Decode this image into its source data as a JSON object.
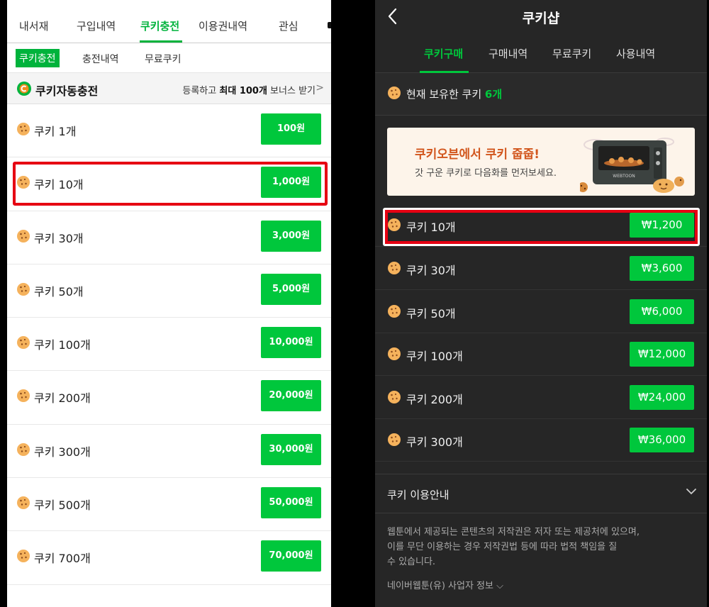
{
  "left": {
    "top_tabs": [
      "내서재",
      "구입내역",
      "쿠키충전",
      "이용권내역",
      "관심"
    ],
    "sub_tabs": [
      "쿠키충전",
      "충전내역",
      "무료쿠키"
    ],
    "auto_charge": {
      "title": "쿠키자동충전",
      "promo_prefix": "등록하고 ",
      "promo_bold": "최대 100개",
      "promo_suffix": " 보너스 받기",
      "chevron": ">"
    },
    "items": [
      {
        "label": "쿠키 1개",
        "price": "100원"
      },
      {
        "label": "쿠키 10개",
        "price": "1,000원"
      },
      {
        "label": "쿠키 30개",
        "price": "3,000원"
      },
      {
        "label": "쿠키 50개",
        "price": "5,000원"
      },
      {
        "label": "쿠키 100개",
        "price": "10,000원"
      },
      {
        "label": "쿠키 200개",
        "price": "20,000원"
      },
      {
        "label": "쿠키 300개",
        "price": "30,000원"
      },
      {
        "label": "쿠키 500개",
        "price": "50,000원"
      },
      {
        "label": "쿠키 700개",
        "price": "70,000원"
      }
    ],
    "colors": {
      "accent": "#00b33c",
      "button": "#00c73c",
      "highlight": "#e60012"
    }
  },
  "right": {
    "title": "쿠키샵",
    "tabs": [
      "쿠키구매",
      "구매내역",
      "무료쿠키",
      "사용내역"
    ],
    "owned_label": "현재 보유한 쿠키 ",
    "owned_count": "6개",
    "banner": {
      "headline": "쿠키오븐에서 쿠키 줍줍!",
      "subtitle": "갓 구운 쿠키로 다음화를 먼저보세요.",
      "oven_text": "WEBTOON"
    },
    "items": [
      {
        "label": "쿠키 10개",
        "price": "₩1,200"
      },
      {
        "label": "쿠키 30개",
        "price": "₩3,600"
      },
      {
        "label": "쿠키 50개",
        "price": "₩6,000"
      },
      {
        "label": "쿠키 100개",
        "price": "₩12,000"
      },
      {
        "label": "쿠키 200개",
        "price": "₩24,000"
      },
      {
        "label": "쿠키 300개",
        "price": "₩36,000"
      }
    ],
    "info_title": "쿠키 이용안내",
    "notice_lines": [
      "웹툰에서 제공되는 콘텐츠의 저작권은 저자 또는 제공처에 있으며,",
      "이를 무단 이용하는 경우 저작권법 등에 따라 법적 책임을 질",
      "수 있습니다."
    ],
    "company_info": "네이버웹툰(유) 사업자 정보 ⌵",
    "colors": {
      "background": "#262626",
      "button": "#00c73c",
      "highlight": "#e60012"
    }
  }
}
